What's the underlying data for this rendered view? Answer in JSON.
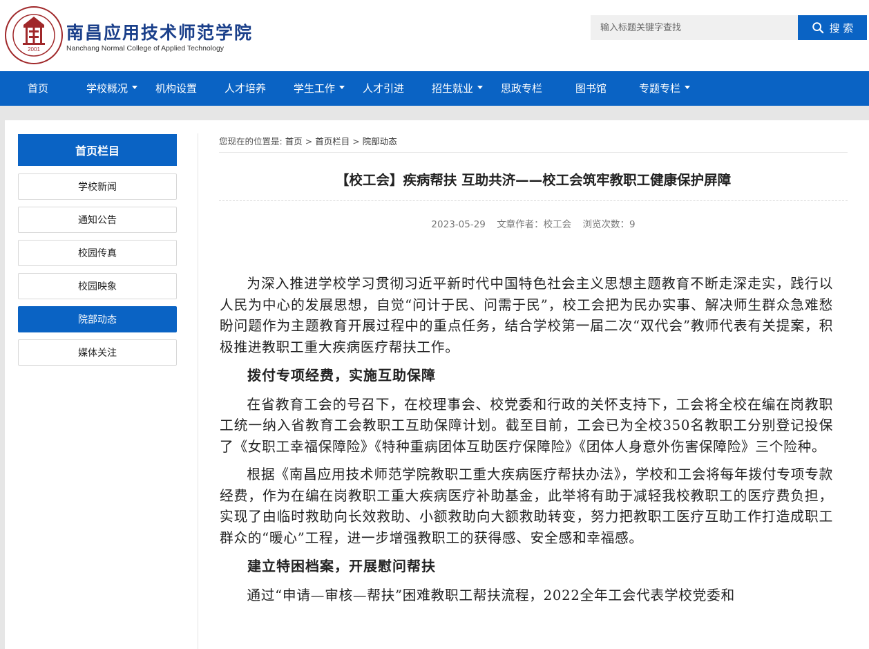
{
  "header": {
    "logo_cn": "南昌应用技术师范学院",
    "logo_en": "Nanchang Normal College of Applied Technology",
    "seal_year": "2001",
    "search_placeholder": "输入标题关键字查找",
    "search_button": "搜 索"
  },
  "nav": [
    {
      "label": "首页",
      "dropdown": false
    },
    {
      "label": "学校概况",
      "dropdown": true
    },
    {
      "label": "机构设置",
      "dropdown": false
    },
    {
      "label": "人才培养",
      "dropdown": false
    },
    {
      "label": "学生工作",
      "dropdown": true
    },
    {
      "label": "人才引进",
      "dropdown": false
    },
    {
      "label": "招生就业",
      "dropdown": true
    },
    {
      "label": "思政专栏",
      "dropdown": false
    },
    {
      "label": "图书馆",
      "dropdown": false
    },
    {
      "label": "专题专栏",
      "dropdown": true
    }
  ],
  "sidebar": {
    "title": "首页栏目",
    "items": [
      {
        "label": "学校新闻",
        "active": false
      },
      {
        "label": "通知公告",
        "active": false
      },
      {
        "label": "校园传真",
        "active": false
      },
      {
        "label": "校园映象",
        "active": false
      },
      {
        "label": "院部动态",
        "active": true
      },
      {
        "label": "媒体关注",
        "active": false
      }
    ]
  },
  "breadcrumb": {
    "prefix": "您现在的位置是:",
    "items": [
      "首页",
      "首页栏目",
      "院部动态"
    ],
    "separator": ">"
  },
  "article": {
    "title": "【校工会】疾病帮扶 互助共济——校工会筑牢教职工健康保护屏障",
    "date": "2023-05-29",
    "author": "文章作者：校工会",
    "views": "浏览次数：9",
    "p1": "为深入推进学校学习贯彻习近平新时代中国特色社会主义思想主题教育不断走深走实，践行以人民为中心的发展思想，自觉“问计于民、问需于民”，校工会把为民办实事、解决师生群众急难愁盼问题作为主题教育开展过程中的重点任务，结合学校第一届二次“双代会”教师代表有关提案，积极推进教职工重大疾病医疗帮扶工作。",
    "h1": "拨付专项经费，实施互助保障",
    "p2": "在省教育工会的号召下，在校理事会、校党委和行政的关怀支持下，工会将全校在编在岗教职工统一纳入省教育工会教职工互助保障计划。截至目前，工会已为全校350名教职工分别登记投保了《女职工幸福保障险》《特种重病团体互助医疗保障险》《团体人身意外伤害保障险》三个险种。",
    "p3": "根据《南昌应用技术师范学院教职工重大疾病医疗帮扶办法》，学校和工会将每年拨付专项专款经费，作为在编在岗教职工重大疾病医疗补助基金，此举将有助于减轻我校教职工的医疗费负担，实现了由临时救助向长效救助、小额救助向大额救助转变，努力把教职工医疗互助工作打造成职工群众的“暖心”工程，进一步增强教职工的获得感、安全感和幸福感。",
    "h2": "建立特困档案，开展慰问帮扶",
    "p4": "通过“申请—审核—帮扶”困难教职工帮扶流程，2022全年工会代表学校党委和"
  },
  "colors": {
    "primary": "#0a63c4",
    "page_bg": "#e6e6e6",
    "logo_red": "#a0282a"
  }
}
